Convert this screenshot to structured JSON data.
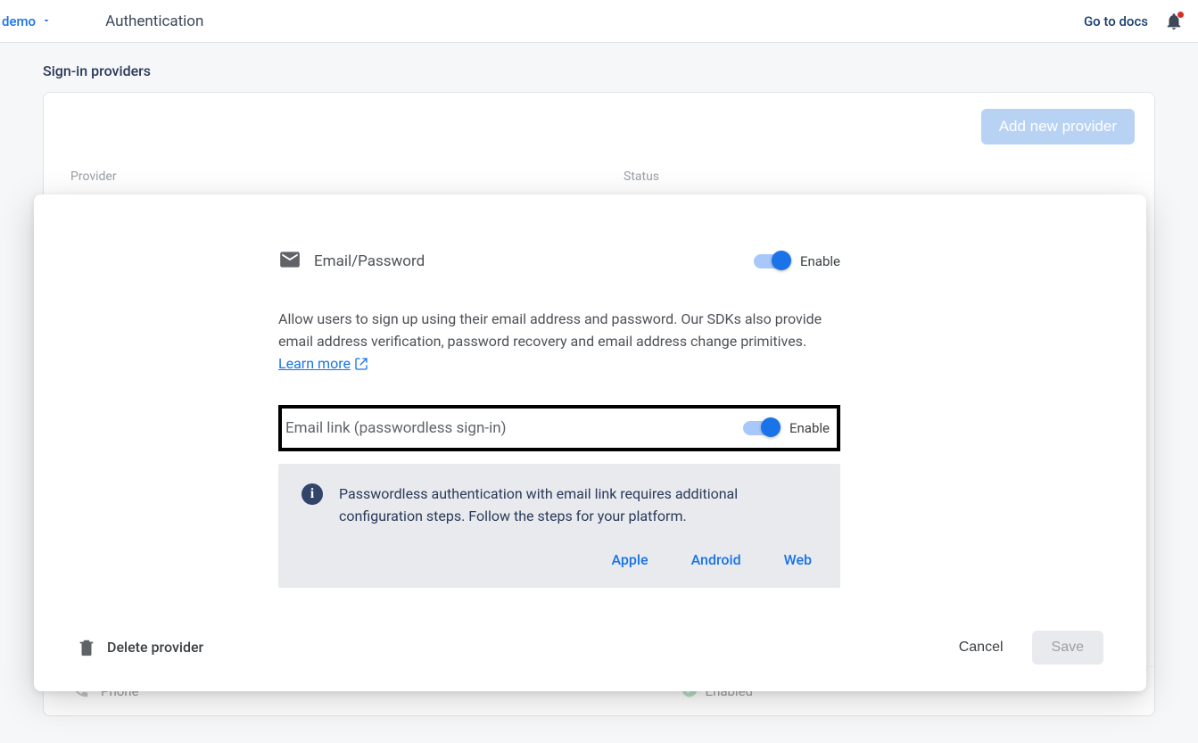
{
  "topbar": {
    "project_name": "demo",
    "page_title": "Authentication",
    "docs_link": "Go to docs"
  },
  "section": {
    "title": "Sign-in providers",
    "add_button": "Add new provider",
    "columns": {
      "provider": "Provider",
      "status": "Status"
    }
  },
  "dialog": {
    "provider_name": "Email/Password",
    "enable_label": "Enable",
    "description_text": "Allow users to sign up using their email address and password. Our SDKs also provide email address verification, password recovery and email address change primitives.",
    "learn_more": "Learn more",
    "email_link_label": "Email link (passwordless sign-in)",
    "email_link_toggle_label": "Enable",
    "info_text": "Passwordless authentication with email link requires additional configuration steps. Follow the steps for your platform.",
    "platforms": {
      "apple": "Apple",
      "android": "Android",
      "web": "Web"
    },
    "delete_label": "Delete provider",
    "cancel_label": "Cancel",
    "save_label": "Save"
  },
  "phone_row": {
    "label": "Phone",
    "status": "Enabled"
  }
}
